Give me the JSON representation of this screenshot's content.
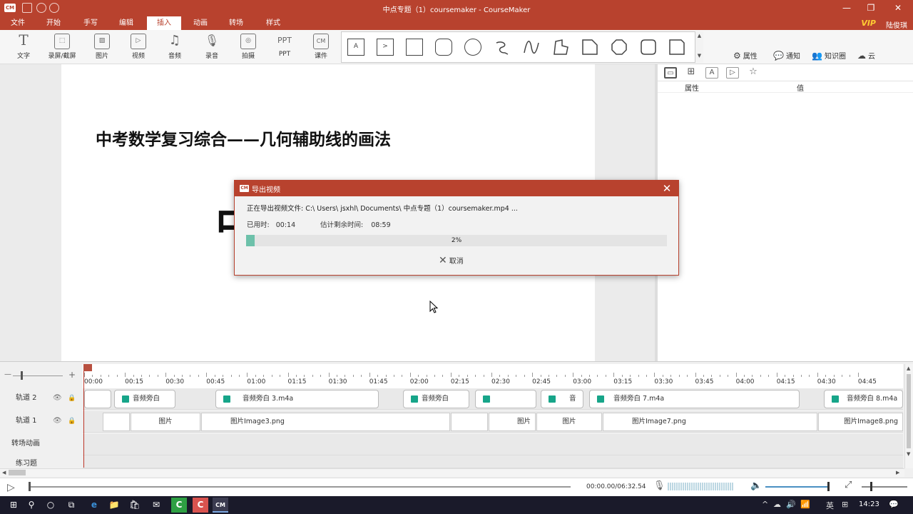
{
  "window": {
    "logo": "CM",
    "title": "中点专题（1）coursemaker - CourseMaker",
    "minimize": "—",
    "restore": "❐",
    "close": "✕"
  },
  "menu": {
    "items": [
      "文件",
      "开始",
      "手写",
      "编辑",
      "插入",
      "动画",
      "转场",
      "样式"
    ],
    "active": "插入",
    "vip": "VIP",
    "user": "陆俊琪"
  },
  "ribbon": {
    "tools": [
      {
        "label": "文字",
        "icon": "T"
      },
      {
        "label": "录屏/截屏",
        "icon": "⬚"
      },
      {
        "label": "图片",
        "icon": "▨"
      },
      {
        "label": "视频",
        "icon": "▷"
      },
      {
        "label": "音频",
        "icon": "♫"
      },
      {
        "label": "录音",
        "icon": "🎙"
      },
      {
        "label": "拍摄",
        "icon": "◎"
      },
      {
        "label": "PPT",
        "icon": "PPT"
      },
      {
        "label": "课件",
        "icon": "CM"
      }
    ],
    "shape_text_a": "A",
    "shape_text_b": ">",
    "scroll_up": "▲",
    "scroll_down": "▼",
    "right_tools": [
      {
        "label": "属性",
        "icon": "⚙"
      },
      {
        "label": "通知",
        "icon": "💬"
      },
      {
        "label": "知识圈",
        "icon": "👥"
      },
      {
        "label": "云",
        "icon": "☁"
      }
    ]
  },
  "slide": {
    "title": "中考数学复习综合——几何辅助线的画法",
    "big_char": "中"
  },
  "properties_panel": {
    "tab_icons": [
      "▭",
      "⊞",
      "A",
      "▷",
      "☆"
    ],
    "col_property": "属性",
    "col_value": "值"
  },
  "export_dialog": {
    "logo": "CM",
    "title": "导出视频",
    "close": "✕",
    "path_text": "正在导出视频文件: C:\\ Users\\ jsxhl\\ Documents\\ 中点专题（1）coursemaker.mp4 ...",
    "elapsed_label": "已用时:",
    "elapsed_value": "00:14",
    "remaining_label": "估计剩余时间:",
    "remaining_value": "08:59",
    "progress_percent": 2,
    "progress_text": "2%",
    "cancel_label": "取消",
    "cancel_icon": "✕"
  },
  "timeline": {
    "zoom_minus": "—",
    "zoom_plus": "+",
    "ticks": [
      "00:00",
      "00:15",
      "00:30",
      "00:45",
      "01:00",
      "01:15",
      "01:30",
      "01:45",
      "02:00",
      "02:15",
      "02:30",
      "02:45",
      "03:00",
      "03:15",
      "03:30",
      "03:45",
      "04:00",
      "04:15",
      "04:30",
      "04:45"
    ],
    "tracks": [
      {
        "label": "轨道 2",
        "eye": "👁",
        "lock": "🔒"
      },
      {
        "label": "轨道 1",
        "eye": "👁",
        "lock": "🔒"
      },
      {
        "label": "转场动画"
      },
      {
        "label": "练习题"
      }
    ],
    "track2_clips": [
      "",
      "音频旁白",
      "音频旁白 3.m4a",
      "音频旁白",
      "",
      "音",
      "音频旁白 7.m4a",
      "音频旁白 8.m4a"
    ],
    "track1_clips": [
      "",
      "图片",
      "图片Image3.png",
      "",
      "图片",
      "图片",
      "图片Image7.png",
      "图片Image8.png"
    ],
    "scroll_left": "◀",
    "scroll_right": "▶",
    "scroll_up": "▲",
    "scroll_down": "▼"
  },
  "playback": {
    "play_icon": "▷",
    "time": "00:00.00/06:32.54",
    "mic_icon": "🎙",
    "speaker_icon": "🔈",
    "fit_icon": "⤢"
  },
  "taskbar": {
    "start": "⊞",
    "search": "⚲",
    "cortana": "○",
    "taskview": "⧉",
    "apps": [
      "e",
      "📁",
      "🛍",
      "✉",
      "C",
      "C",
      "CM"
    ],
    "tray_icons": [
      "^",
      "☁",
      "🔊",
      "📶",
      "英",
      "⊞"
    ],
    "lang": "英",
    "time": "14:23",
    "notify": "💬"
  }
}
